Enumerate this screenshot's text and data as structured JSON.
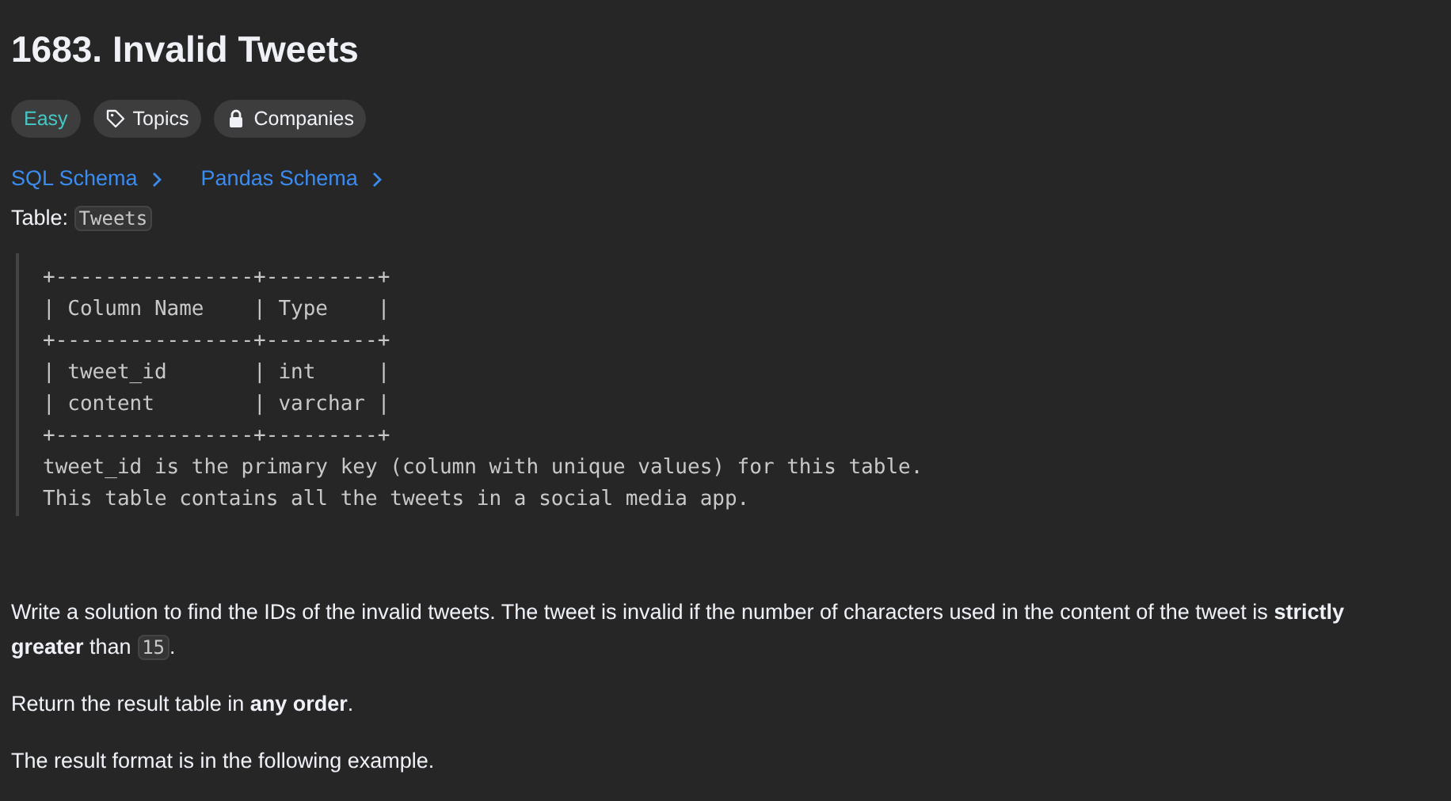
{
  "title": "1683. Invalid Tweets",
  "tags": [
    {
      "kind": "difficulty",
      "label": "Easy"
    },
    {
      "kind": "topics",
      "label": "Topics"
    },
    {
      "kind": "companies",
      "label": "Companies"
    }
  ],
  "schema_links": [
    "SQL Schema",
    "Pandas Schema"
  ],
  "table_line": [
    {
      "kind": "text",
      "text": "Table: "
    },
    {
      "kind": "code",
      "text": "Tweets"
    }
  ],
  "schema_block": [
    "+----------------+---------+",
    "| Column Name    | Type    |",
    "+----------------+---------+",
    "| tweet_id       | int     |",
    "| content        | varchar |",
    "+----------------+---------+",
    "tweet_id is the primary key (column with unique values) for this table.",
    "This table contains all the tweets in a social media app."
  ],
  "paragraphs": [
    [
      {
        "kind": "text",
        "text": "Write a solution to find the IDs of the invalid tweets. The tweet is invalid if the number of characters used in the content of the tweet is **strictly greater** than "
      },
      {
        "kind": "code",
        "text": "15"
      },
      {
        "kind": "text",
        "text": "."
      }
    ],
    [
      {
        "kind": "text",
        "text": "Return the result table in **any order**."
      }
    ],
    [
      {
        "kind": "text",
        "text": "The result format is in the following example."
      }
    ]
  ]
}
